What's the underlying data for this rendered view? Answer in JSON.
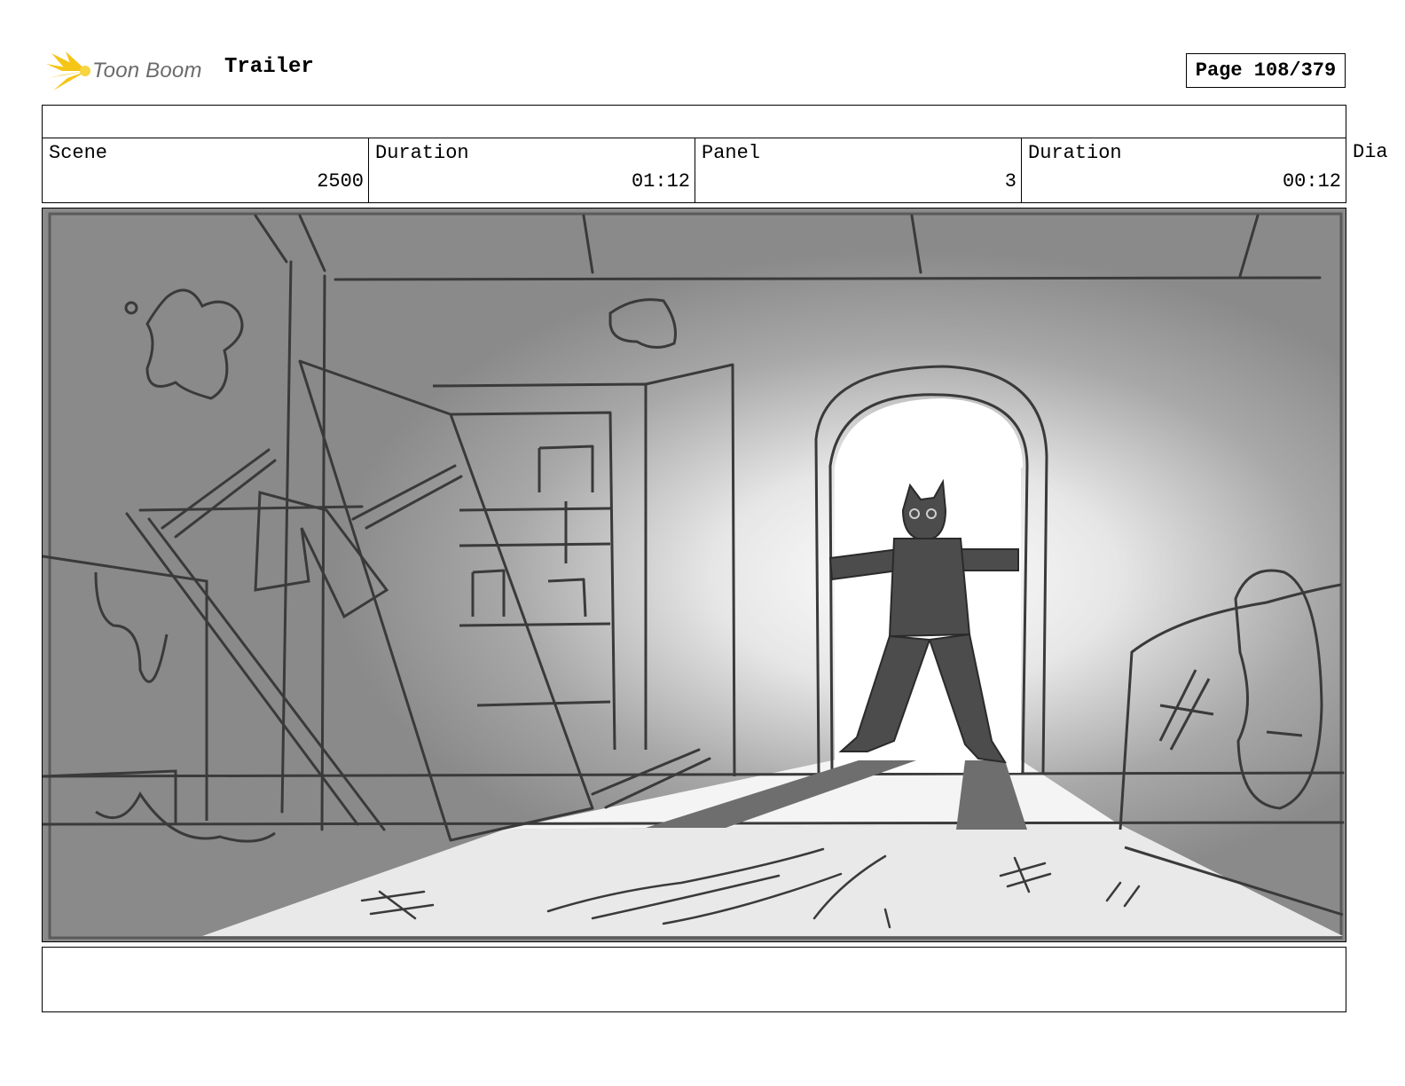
{
  "header": {
    "logo_text": "Toon Boom",
    "title": "Trailer",
    "page_label": "Page 108/379"
  },
  "info": {
    "scene_label": "Scene",
    "scene_value": "2500",
    "scene_duration_label": "Duration",
    "scene_duration_value": "01:12",
    "panel_label": "Panel",
    "panel_value": "3",
    "panel_duration_label": "Duration",
    "panel_duration_value": "00:12",
    "cut_off_label": "Dia"
  },
  "colors": {
    "logo_accent": "#f5c518",
    "sketch_bg": "#8a8a8a",
    "sketch_line": "#3a3a3a",
    "light": "#ffffff"
  }
}
